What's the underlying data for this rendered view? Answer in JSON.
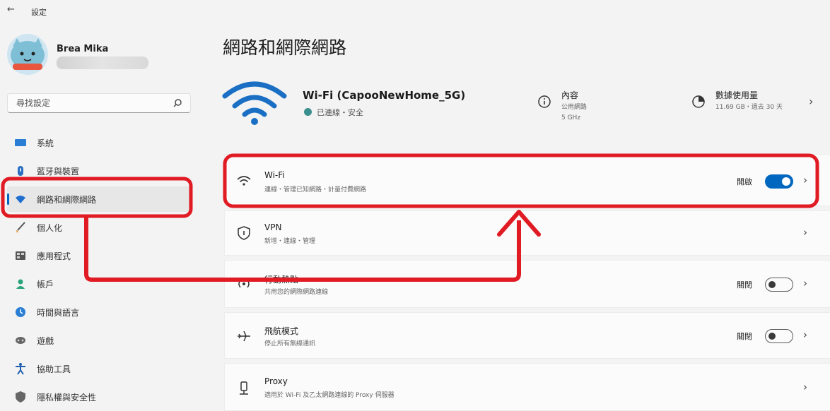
{
  "topbar": {
    "back_icon": "back-arrow-icon",
    "title": "設定"
  },
  "user": {
    "name": "Brea Mika"
  },
  "search": {
    "placeholder": "尋找設定"
  },
  "nav": [
    {
      "id": "system",
      "label": "系統",
      "icon": "monitor-icon"
    },
    {
      "id": "bluetooth",
      "label": "藍牙與裝置",
      "icon": "bluetooth-devices-icon"
    },
    {
      "id": "network",
      "label": "網路和網際網路",
      "icon": "wifi-icon",
      "active": true
    },
    {
      "id": "personalization",
      "label": "個人化",
      "icon": "brush-icon"
    },
    {
      "id": "apps",
      "label": "應用程式",
      "icon": "apps-icon"
    },
    {
      "id": "accounts",
      "label": "帳戶",
      "icon": "person-icon"
    },
    {
      "id": "time",
      "label": "時間與語言",
      "icon": "globe-clock-icon"
    },
    {
      "id": "gaming",
      "label": "遊戲",
      "icon": "gamepad-icon"
    },
    {
      "id": "accessibility",
      "label": "協助工具",
      "icon": "accessibility-icon"
    },
    {
      "id": "privacy",
      "label": "隱私權與安全性",
      "icon": "shield-icon"
    }
  ],
  "main": {
    "title": "網路和網際網路",
    "network": {
      "name": "Wi-Fi (CapooNewHome_5G)",
      "status": "已連線・安全",
      "properties": {
        "title": "內容",
        "line1": "公用網路",
        "line2": "5 GHz"
      },
      "data_usage": {
        "title": "數據使用量",
        "detail": "11.69 GB・過去 30 天"
      }
    },
    "cards": [
      {
        "id": "wifi",
        "title": "Wi-Fi",
        "subtitle": "連線・管理已知網路・計量付費網路",
        "state": "開啟",
        "toggle": "on",
        "icon": "wifi-icon"
      },
      {
        "id": "vpn",
        "title": "VPN",
        "subtitle": "新增・連線・管理",
        "state": "",
        "toggle": "none",
        "icon": "vpn-shield-icon"
      },
      {
        "id": "hotspot",
        "title": "行動熱點",
        "subtitle": "共用您的網際網路連線",
        "state": "關閉",
        "toggle": "off",
        "icon": "hotspot-icon"
      },
      {
        "id": "airplane",
        "title": "飛航模式",
        "subtitle": "停止所有無線通訊",
        "state": "關閉",
        "toggle": "off",
        "icon": "airplane-icon"
      },
      {
        "id": "proxy",
        "title": "Proxy",
        "subtitle": "適用於 Wi-Fi 及乙太網路連線的 Proxy 伺服器",
        "state": "",
        "toggle": "none",
        "icon": "proxy-icon"
      }
    ]
  },
  "colors": {
    "accent": "#0067c0",
    "annotation": "#e01b24",
    "background": "#f3f3f3",
    "card": "#fbfbfb"
  }
}
